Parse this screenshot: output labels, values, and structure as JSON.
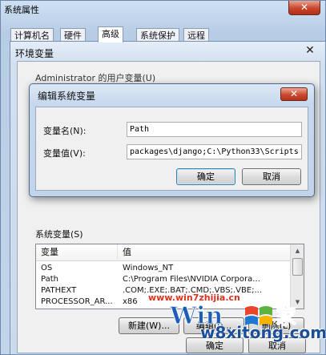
{
  "system_properties": {
    "title": "系统属性",
    "tabs": [
      "计算机名",
      "硬件",
      "高级",
      "系统保护",
      "远程"
    ],
    "active_tab": "高级",
    "bottom_buttons": [
      "确定",
      "取消"
    ]
  },
  "environment_variables": {
    "title": "环境变量",
    "user_group_label": "Administrator 的用户变量(U)",
    "system_group_label": "系统变量(S)",
    "columns": [
      "变量",
      "值"
    ],
    "rows": [
      {
        "name": "OS",
        "value": "Windows_NT"
      },
      {
        "name": "Path",
        "value": "C:\\Program Files\\NVIDIA Corpora..."
      },
      {
        "name": "PATHEXT",
        "value": ".COM;.EXE;.BAT;.CMD;.VBS;.VBE;..."
      },
      {
        "name": "PROCESSOR_AR...",
        "value": "x86"
      }
    ],
    "buttons": {
      "new": "新建(W)...",
      "edit": "编辑(I)...",
      "delete": "删除(L)"
    }
  },
  "edit_dialog": {
    "title": "编辑系统变量",
    "name_label": "变量名(N):",
    "name_value": "Path",
    "value_label": "变量值(V):",
    "value_value": "packages\\django;C:\\Python33\\Scripts",
    "ok": "确定",
    "cancel": "取消"
  },
  "watermark": {
    "url": "www.win7zhijia.cn",
    "domain": "w8xitong.com"
  },
  "icons": {
    "close": "close-icon"
  }
}
